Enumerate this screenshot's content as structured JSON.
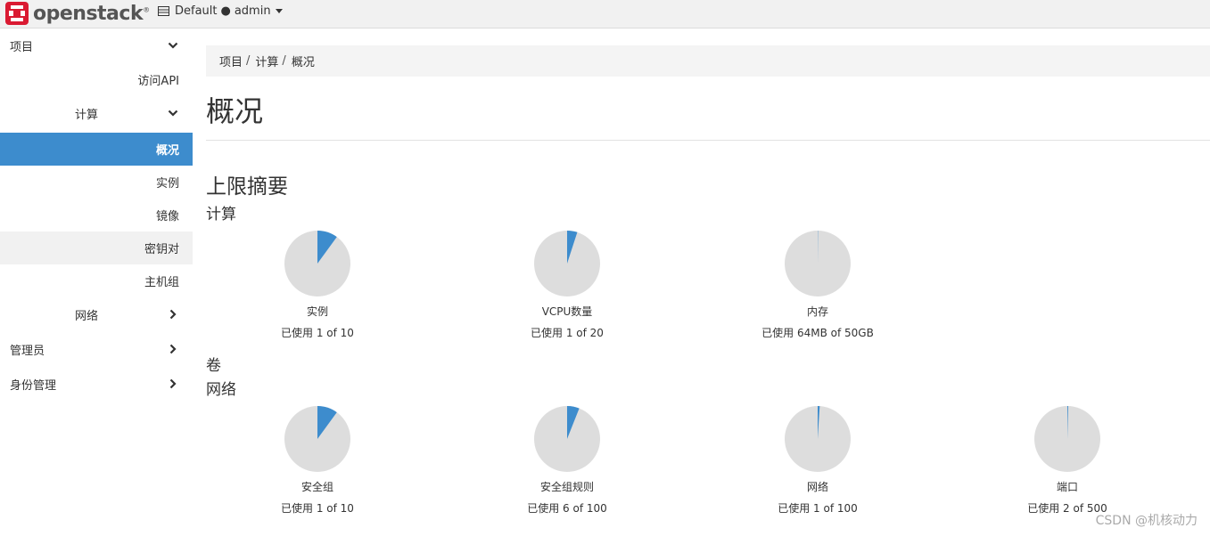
{
  "navbar": {
    "brand": "openstack",
    "brand_reg": "®",
    "domain": "Default",
    "dot": "●",
    "user": "admin"
  },
  "sidebar": {
    "items": [
      {
        "label": "项目",
        "level": 0,
        "chevron": "down"
      },
      {
        "label": "访问API",
        "level": 2
      },
      {
        "label": "计算",
        "level": 1,
        "chevron": "down"
      },
      {
        "label": "概况",
        "level": 2,
        "active": true
      },
      {
        "label": "实例",
        "level": 2
      },
      {
        "label": "镜像",
        "level": 2
      },
      {
        "label": "密钥对",
        "level": 2,
        "hover": true
      },
      {
        "label": "主机组",
        "level": 2
      },
      {
        "label": "网络",
        "level": 1,
        "chevron": "right"
      },
      {
        "label": "管理员",
        "level": 0,
        "chevron": "right"
      },
      {
        "label": "身份管理",
        "level": 0,
        "chevron": "right"
      }
    ]
  },
  "breadcrumb": {
    "items": [
      "项目",
      "计算",
      "概况"
    ],
    "separator": "/"
  },
  "page_title": "概况",
  "limits": {
    "title": "上限摘要",
    "groups": {
      "compute": "计算",
      "volume": "卷",
      "network": "网络"
    }
  },
  "colors": {
    "used": "#3d8ccd",
    "free": "#dddddd"
  },
  "charts": {
    "compute": [
      {
        "name": "实例",
        "usage": "已使用 1 of 10",
        "used": 1,
        "total": 10
      },
      {
        "name": "VCPU数量",
        "usage": "已使用 1 of 20",
        "used": 1,
        "total": 20
      },
      {
        "name": "内存",
        "usage": "已使用 64MB of 50GB",
        "used": 64,
        "total": 51200
      }
    ],
    "network": [
      {
        "name": "安全组",
        "usage": "已使用 1 of 10",
        "used": 1,
        "total": 10
      },
      {
        "name": "安全组规则",
        "usage": "已使用 6 of 100",
        "used": 6,
        "total": 100
      },
      {
        "name": "网络",
        "usage": "已使用 1 of 100",
        "used": 1,
        "total": 100
      },
      {
        "name": "端口",
        "usage": "已使用 2 of 500",
        "used": 2,
        "total": 500
      }
    ]
  },
  "watermark": "CSDN @机核动力"
}
